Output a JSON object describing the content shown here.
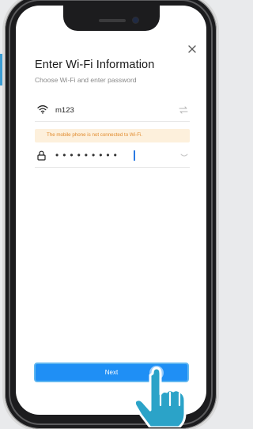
{
  "dialog": {
    "title": "Enter Wi-Fi Information",
    "subtitle": "Choose Wi-Fi and enter password",
    "close_icon": "close-icon"
  },
  "wifi": {
    "icon": "wifi-icon",
    "ssid": "m123",
    "switch_icon": "swap-icon"
  },
  "warning": {
    "text": "The mobile phone is not connected to Wi-Fi.",
    "color": "#e0892a",
    "background": "#fdf0dc"
  },
  "password": {
    "icon": "lock-icon",
    "masked_value": "•••••••••",
    "visibility_icon": "eye-closed-icon"
  },
  "actions": {
    "next_label": "Next",
    "accent": "#1f8ff5"
  },
  "overlay": {
    "pointer_icon": "tap-hand-icon",
    "side_tab_color": "#3a9cd3"
  }
}
